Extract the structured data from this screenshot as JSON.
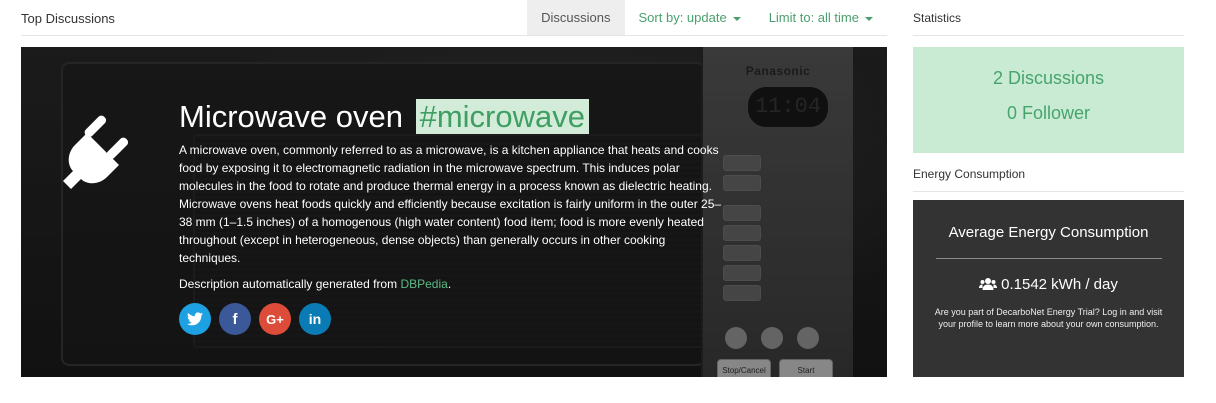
{
  "header": {
    "title": "Top Discussions",
    "tabs": [
      {
        "label": "Discussions",
        "active": true
      },
      {
        "label": "Sort by: update",
        "dropdown": true
      },
      {
        "label": "Limit to: all time",
        "dropdown": true
      }
    ]
  },
  "hero": {
    "title": "Microwave oven",
    "hashtag": "#microwave",
    "icon": "plug-icon",
    "description": "A microwave oven, commonly referred to as a microwave, is a kitchen appliance that heats and cooks food by exposing it to electromagnetic radiation in the microwave spectrum. This induces polar molecules in the food to rotate and produce thermal energy in a process known as dielectric heating. Microwave ovens heat foods quickly and efficiently because excitation is fairly uniform in the outer 25–38 mm (1–1.5 inches) of a homogenous (high water content) food item; food is more evenly heated throughout (except in heterogeneous, dense objects) than generally occurs in other cooking techniques.",
    "source_prefix": "Description automatically generated from ",
    "source_link": "DBPedia",
    "source_suffix": ".",
    "background": {
      "brand": "Panasonic",
      "display": "11:04",
      "button_stop": "Stop/Cancel",
      "button_start": "Start"
    },
    "social": [
      {
        "name": "twitter-icon",
        "glyph": "t"
      },
      {
        "name": "facebook-icon",
        "glyph": "f"
      },
      {
        "name": "google-plus-icon",
        "glyph": "G+"
      },
      {
        "name": "linkedin-icon",
        "glyph": "in"
      }
    ]
  },
  "sidebar": {
    "statistics_heading": "Statistics",
    "discussions": "2 Discussions",
    "followers": "0 Follower",
    "energy_heading": "Energy Consumption",
    "energy_title": "Average Energy Consumption",
    "energy_value": "0.1542 kWh / day",
    "energy_note": "Are you part of DecarboNet Energy Trial? Log in and visit your profile to learn more about your own consumption."
  },
  "colors": {
    "accent": "#4a9f6e",
    "hashtag_bg": "#d2ecd9",
    "stats_bg": "#c9ebd4",
    "energy_bg": "#333333"
  }
}
